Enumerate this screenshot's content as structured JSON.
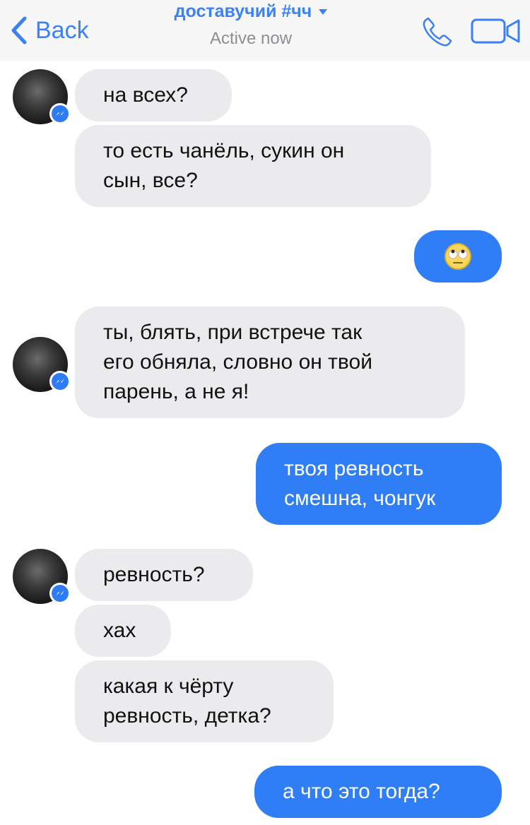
{
  "header": {
    "back_label": "Back",
    "contact_name": "доставучий #чч",
    "status": "Active now",
    "accent_color": "#3b82f6",
    "icons": [
      "chevron-left-icon",
      "caret-down-icon",
      "phone-icon",
      "video-camera-icon"
    ]
  },
  "messages": [
    {
      "from": "them",
      "text": "на всех?"
    },
    {
      "from": "them",
      "text": "то есть чанёль, сукин он\nсын, все?"
    },
    {
      "from": "me",
      "emoji": "face-with-rolling-eyes-icon"
    },
    {
      "from": "them",
      "text": "ты, блять, при встрече так\nего обняла, словно он твой\nпарень, а не я!"
    },
    {
      "from": "me",
      "text": "твоя ревность\nсмешна, чонгук"
    },
    {
      "from": "them",
      "text": "ревность?"
    },
    {
      "from": "them",
      "text": "хах"
    },
    {
      "from": "them",
      "text": "какая к чёрту\nревность, детка?"
    },
    {
      "from": "me",
      "text": "а что это тогда?"
    }
  ],
  "colors": {
    "incoming_bubble": "#ebebed",
    "outgoing_bubble": "#2f7ef5",
    "header_bg": "#f7f7f8"
  }
}
